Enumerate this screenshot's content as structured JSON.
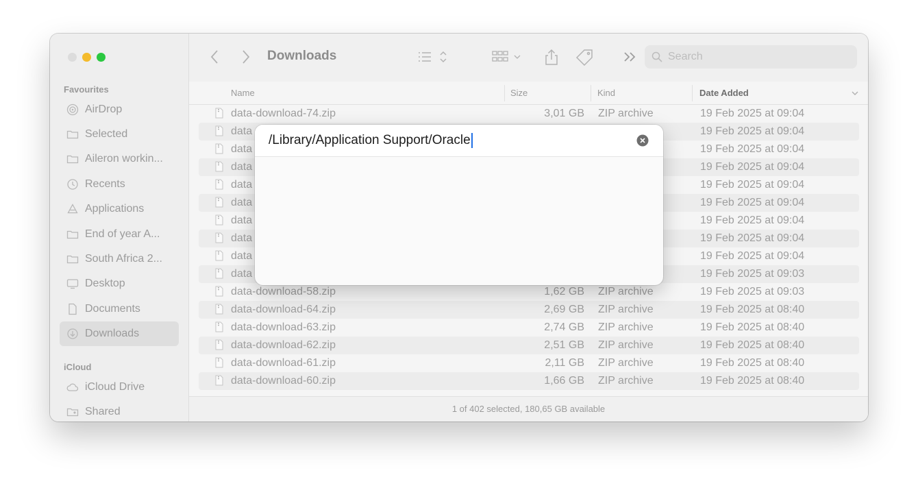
{
  "sidebar": {
    "sections": {
      "favourites": "Favourites",
      "icloud": "iCloud"
    },
    "items": [
      {
        "label": "AirDrop",
        "icon": "airdrop-icon"
      },
      {
        "label": "Selected",
        "icon": "folder-icon"
      },
      {
        "label": "Aileron workin...",
        "icon": "folder-icon"
      },
      {
        "label": "Recents",
        "icon": "clock-icon"
      },
      {
        "label": "Applications",
        "icon": "applications-icon"
      },
      {
        "label": "End of year A...",
        "icon": "folder-icon"
      },
      {
        "label": "South Africa 2...",
        "icon": "folder-icon"
      },
      {
        "label": "Desktop",
        "icon": "desktop-icon"
      },
      {
        "label": "Documents",
        "icon": "document-icon"
      },
      {
        "label": "Downloads",
        "icon": "download-icon",
        "selected": true
      }
    ],
    "icloud_items": [
      {
        "label": "iCloud Drive",
        "icon": "cloud-icon"
      },
      {
        "label": "Shared",
        "icon": "shared-folder-icon"
      }
    ]
  },
  "toolbar": {
    "title": "Downloads",
    "search_placeholder": "Search"
  },
  "columns": {
    "name": "Name",
    "size": "Size",
    "kind": "Kind",
    "date_added": "Date Added"
  },
  "files": [
    {
      "name": "data-download-74.zip",
      "size": "3,01 GB",
      "kind": "ZIP archive",
      "date": "19 Feb 2025 at 09:04"
    },
    {
      "name": "data",
      "size": "",
      "kind": "",
      "date": "19 Feb 2025 at 09:04"
    },
    {
      "name": "data",
      "size": "",
      "kind": "",
      "date": "19 Feb 2025 at 09:04"
    },
    {
      "name": "data",
      "size": "",
      "kind": "",
      "date": "19 Feb 2025 at 09:04"
    },
    {
      "name": "data",
      "size": "",
      "kind": "",
      "date": "19 Feb 2025 at 09:04"
    },
    {
      "name": "data",
      "size": "",
      "kind": "",
      "date": "19 Feb 2025 at 09:04"
    },
    {
      "name": "data",
      "size": "",
      "kind": "",
      "date": "19 Feb 2025 at 09:04"
    },
    {
      "name": "data",
      "size": "",
      "kind": "",
      "date": "19 Feb 2025 at 09:04"
    },
    {
      "name": "data",
      "size": "",
      "kind": "",
      "date": "19 Feb 2025 at 09:04"
    },
    {
      "name": "data",
      "size": "",
      "kind": "",
      "date": "19 Feb 2025 at 09:03"
    },
    {
      "name": "data-download-58.zip",
      "size": "1,62 GB",
      "kind": "ZIP archive",
      "date": "19 Feb 2025 at 09:03"
    },
    {
      "name": "data-download-64.zip",
      "size": "2,69 GB",
      "kind": "ZIP archive",
      "date": "19 Feb 2025 at 08:40"
    },
    {
      "name": "data-download-63.zip",
      "size": "2,74 GB",
      "kind": "ZIP archive",
      "date": "19 Feb 2025 at 08:40"
    },
    {
      "name": "data-download-62.zip",
      "size": "2,51 GB",
      "kind": "ZIP archive",
      "date": "19 Feb 2025 at 08:40"
    },
    {
      "name": "data-download-61.zip",
      "size": "2,11 GB",
      "kind": "ZIP archive",
      "date": "19 Feb 2025 at 08:40"
    },
    {
      "name": "data-download-60.zip",
      "size": "1,66 GB",
      "kind": "ZIP archive",
      "date": "19 Feb 2025 at 08:40"
    }
  ],
  "status": "1 of 402 selected, 180,65 GB available",
  "dialog": {
    "path": "/Library/Application Support/Oracle"
  },
  "colors": {
    "accent_caret": "#1f6fe5",
    "traffic_close": "#dcdcdc",
    "traffic_minimize": "#f4bb2c",
    "traffic_maximize": "#2ac840"
  }
}
